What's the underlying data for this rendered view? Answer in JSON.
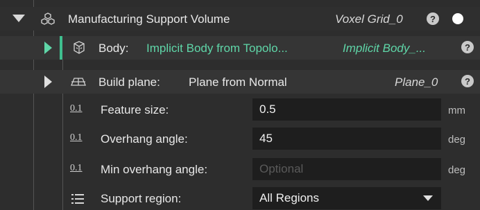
{
  "header": {
    "title": "Manufacturing Support Volume",
    "type": "Voxel Grid_0",
    "help": "?"
  },
  "body_row": {
    "label": "Body:",
    "value": "Implicit Body from Topolo...",
    "type": "Implicit Body_...",
    "help": "?"
  },
  "build_plane_row": {
    "label": "Build plane:",
    "value": "Plane from Normal",
    "type": "Plane_0",
    "help": "?"
  },
  "params": [
    {
      "tag": "0.1",
      "label": "Feature size:",
      "value": "0.5",
      "placeholder": "",
      "unit": "mm"
    },
    {
      "tag": "0.1",
      "label": "Overhang angle:",
      "value": "45",
      "placeholder": "",
      "unit": "deg"
    },
    {
      "tag": "0.1",
      "label": "Min overhang angle:",
      "value": "",
      "placeholder": "Optional",
      "unit": "deg"
    }
  ],
  "support_region": {
    "label": "Support region:",
    "value": "All Regions"
  },
  "colors": {
    "accent": "#5fd6a8",
    "highlight_bar": "#3fbf8f",
    "background": "#2d2d2d",
    "input_bg": "#1e1e1e"
  }
}
